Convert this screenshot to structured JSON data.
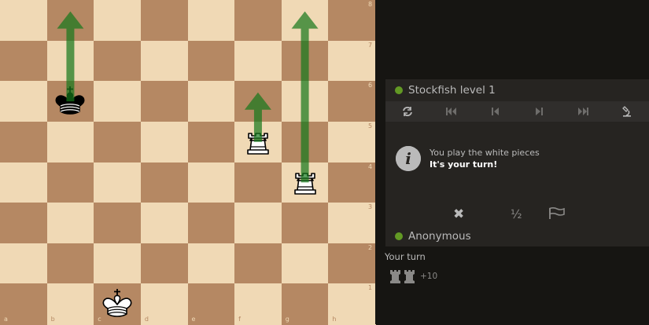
{
  "board": {
    "light_color": "#f0d9b5",
    "dark_color": "#b58863",
    "arrow_color": "#15781b",
    "files": [
      "a",
      "b",
      "c",
      "d",
      "e",
      "f",
      "g",
      "h"
    ],
    "ranks": [
      "8",
      "7",
      "6",
      "5",
      "4",
      "3",
      "2",
      "1"
    ],
    "pieces": [
      {
        "color": "black",
        "type": "king",
        "square": "b6"
      },
      {
        "color": "white",
        "type": "rook",
        "square": "f5"
      },
      {
        "color": "white",
        "type": "rook",
        "square": "g4"
      },
      {
        "color": "white",
        "type": "king",
        "square": "c1"
      }
    ],
    "arrows": [
      {
        "from": "b6",
        "to": "b8"
      },
      {
        "from": "f5",
        "to": "f6"
      },
      {
        "from": "g4",
        "to": "g8"
      }
    ]
  },
  "panel": {
    "opponent": {
      "name": "Stockfish level 1",
      "online": true,
      "status_color": "#629924"
    },
    "controls": [
      {
        "name": "flip-board",
        "icon": "flip-icon"
      },
      {
        "name": "first-move",
        "icon": "first-icon"
      },
      {
        "name": "prev-move",
        "icon": "prev-icon"
      },
      {
        "name": "next-move",
        "icon": "next-icon"
      },
      {
        "name": "last-move",
        "icon": "last-icon"
      },
      {
        "name": "analysis",
        "icon": "microscope-icon"
      }
    ],
    "message": {
      "icon": "info-icon",
      "line1": "You play the white pieces",
      "line2": "It's your turn!"
    },
    "actions": {
      "abort": "✖",
      "draw": "½",
      "resign_icon": "flag-icon"
    },
    "player": {
      "name": "Anonymous",
      "online": true
    },
    "turn_text": "Your turn",
    "material": {
      "pieces": [
        "rook",
        "rook"
      ],
      "score": "+10"
    }
  }
}
